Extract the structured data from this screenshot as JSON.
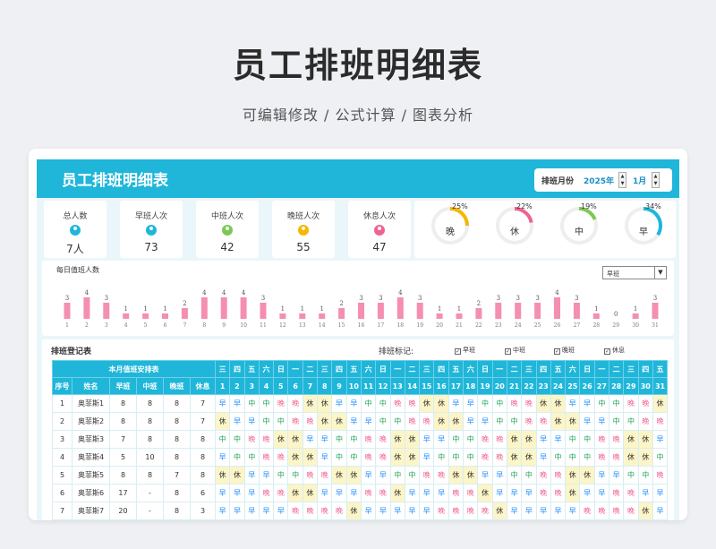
{
  "page": {
    "title": "员工排班明细表",
    "subtitle": "可编辑修改 /  公式计算  /  图表分析"
  },
  "app": {
    "title": "员工排班明细表",
    "month_label": "排班月份",
    "year": "2025年",
    "month": "1月"
  },
  "stats": [
    {
      "label": "总人数",
      "value": "7人",
      "icon": "user-icon",
      "color": "#1fb6d9"
    },
    {
      "label": "早班人次",
      "value": "73",
      "icon": "user-icon",
      "color": "#1fb6d9"
    },
    {
      "label": "中班人次",
      "value": "42",
      "icon": "user-icon",
      "color": "#7dc855"
    },
    {
      "label": "晚班人次",
      "value": "55",
      "icon": "user-icon",
      "color": "#f5b700"
    },
    {
      "label": "休息人次",
      "value": "47",
      "icon": "user-icon",
      "color": "#f06292"
    }
  ],
  "donuts": [
    {
      "label": "晚",
      "percent": "25%",
      "fraction": 0.25,
      "color": "#f5b700"
    },
    {
      "label": "休",
      "percent": "22%",
      "fraction": 0.22,
      "color": "#f06292"
    },
    {
      "label": "中",
      "percent": "19%",
      "fraction": 0.19,
      "color": "#7dc855"
    },
    {
      "label": "早",
      "percent": "34%",
      "fraction": 0.34,
      "color": "#1fb6d9"
    }
  ],
  "daily": {
    "title": "每日值班人数",
    "selected_shift": "早班",
    "days": [
      1,
      2,
      3,
      4,
      5,
      6,
      7,
      8,
      9,
      10,
      11,
      12,
      13,
      14,
      15,
      16,
      17,
      18,
      19,
      20,
      21,
      22,
      23,
      24,
      25,
      26,
      27,
      28,
      29,
      30,
      31
    ],
    "counts": [
      3,
      4,
      3,
      1,
      1,
      1,
      2,
      4,
      4,
      4,
      3,
      1,
      1,
      1,
      2,
      3,
      3,
      4,
      3,
      1,
      1,
      2,
      3,
      3,
      3,
      4,
      3,
      1,
      0,
      1,
      3
    ]
  },
  "register": {
    "title": "排班登记表",
    "legend_label": "排班标记:",
    "legend": [
      "早班",
      "中班",
      "晚班",
      "休息"
    ],
    "group_header": "本月值班安排表",
    "columns": [
      "序号",
      "姓名",
      "早班",
      "中班",
      "晚班",
      "休息"
    ],
    "weekdays": [
      "三",
      "四",
      "五",
      "六",
      "日",
      "一",
      "二",
      "三",
      "四",
      "五",
      "六",
      "日",
      "一",
      "二",
      "三",
      "四",
      "五",
      "六",
      "日",
      "一",
      "二",
      "三",
      "四",
      "五",
      "六",
      "日",
      "一",
      "二",
      "三",
      "四",
      "五"
    ],
    "day_numbers": [
      "1",
      "2",
      "3",
      "4",
      "5",
      "6",
      "7",
      "8",
      "9",
      "10",
      "11",
      "12",
      "13",
      "14",
      "15",
      "16",
      "17",
      "18",
      "19",
      "20",
      "21",
      "22",
      "23",
      "24",
      "25",
      "26",
      "27",
      "28",
      "29",
      "30",
      "31"
    ],
    "rows": [
      {
        "no": "1",
        "name": "奥菲斯1",
        "zao": "8",
        "zhong": "8",
        "wan": "8",
        "xiu": "7",
        "shifts": [
          "早",
          "早",
          "中",
          "中",
          "晚",
          "晚",
          "休",
          "休",
          "早",
          "早",
          "中",
          "中",
          "晚",
          "晚",
          "休",
          "休",
          "早",
          "早",
          "中",
          "中",
          "晚",
          "晚",
          "休",
          "休",
          "早",
          "早",
          "中",
          "中",
          "晚",
          "晚",
          "休"
        ]
      },
      {
        "no": "2",
        "name": "奥菲斯2",
        "zao": "8",
        "zhong": "8",
        "wan": "8",
        "xiu": "7",
        "shifts": [
          "休",
          "早",
          "早",
          "中",
          "中",
          "晚",
          "晚",
          "休",
          "休",
          "早",
          "早",
          "中",
          "中",
          "晚",
          "晚",
          "休",
          "休",
          "早",
          "早",
          "中",
          "中",
          "晚",
          "晚",
          "休",
          "休",
          "早",
          "早",
          "中",
          "中",
          "晚",
          "晚"
        ]
      },
      {
        "no": "3",
        "name": "奥菲斯3",
        "zao": "7",
        "zhong": "8",
        "wan": "8",
        "xiu": "8",
        "shifts": [
          "中",
          "中",
          "晚",
          "晚",
          "休",
          "休",
          "早",
          "早",
          "中",
          "中",
          "晚",
          "晚",
          "休",
          "休",
          "早",
          "早",
          "中",
          "中",
          "晚",
          "晚",
          "休",
          "休",
          "早",
          "早",
          "中",
          "中",
          "晚",
          "晚",
          "休",
          "休",
          "早"
        ]
      },
      {
        "no": "4",
        "name": "奥菲斯4",
        "zao": "5",
        "zhong": "10",
        "wan": "8",
        "xiu": "8",
        "shifts": [
          "早",
          "中",
          "中",
          "晚",
          "晚",
          "休",
          "休",
          "早",
          "中",
          "中",
          "晚",
          "晚",
          "休",
          "休",
          "早",
          "中",
          "中",
          "中",
          "晚",
          "晚",
          "休",
          "休",
          "早",
          "中",
          "中",
          "中",
          "晚",
          "晚",
          "休",
          "休",
          "中"
        ]
      },
      {
        "no": "5",
        "name": "奥菲斯5",
        "zao": "8",
        "zhong": "8",
        "wan": "7",
        "xiu": "8",
        "shifts": [
          "休",
          "休",
          "早",
          "早",
          "中",
          "中",
          "晚",
          "晚",
          "休",
          "休",
          "早",
          "早",
          "中",
          "中",
          "晚",
          "晚",
          "休",
          "休",
          "早",
          "早",
          "中",
          "中",
          "晚",
          "晚",
          "休",
          "休",
          "早",
          "早",
          "中",
          "中",
          "晚"
        ]
      },
      {
        "no": "6",
        "name": "奥菲斯6",
        "zao": "17",
        "zhong": "-",
        "wan": "8",
        "xiu": "6",
        "shifts": [
          "早",
          "早",
          "早",
          "晚",
          "晚",
          "休",
          "休",
          "早",
          "早",
          "早",
          "晚",
          "晚",
          "休",
          "早",
          "早",
          "早",
          "晚",
          "晚",
          "休",
          "早",
          "早",
          "早",
          "晚",
          "晚",
          "休",
          "早",
          "早",
          "晚",
          "晚",
          "早",
          "早"
        ]
      },
      {
        "no": "7",
        "name": "奥菲斯7",
        "zao": "20",
        "zhong": "-",
        "wan": "8",
        "xiu": "3",
        "shifts": [
          "早",
          "早",
          "早",
          "早",
          "早",
          "晚",
          "晚",
          "晚",
          "晚",
          "休",
          "早",
          "早",
          "早",
          "早",
          "早",
          "晚",
          "晚",
          "晚",
          "晚",
          "休",
          "早",
          "早",
          "早",
          "早",
          "早",
          "晚",
          "晚",
          "晚",
          "晚",
          "休",
          "早"
        ]
      }
    ]
  },
  "colors": {
    "accent": "#1fb6d9",
    "bar": "#f48fb1",
    "zao": "#1e90ff",
    "zhong": "#22a35a",
    "wan": "#f06292",
    "xiu_bg": "#fcf5c8"
  }
}
